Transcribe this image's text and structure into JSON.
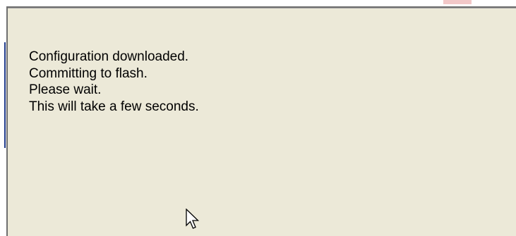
{
  "dialog": {
    "message_lines": [
      "Configuration downloaded.",
      "Committing to flash.",
      "Please wait.",
      "This will take a few seconds."
    ],
    "background_color": "#ece9d8"
  },
  "cursor": {
    "icon": "arrow-pointer-icon"
  }
}
